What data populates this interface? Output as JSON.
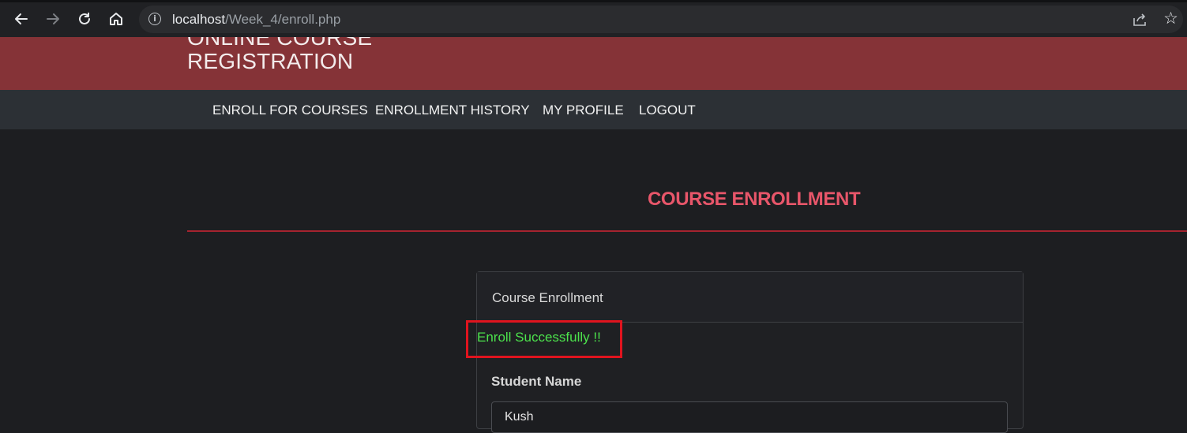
{
  "browser": {
    "url_host": "localhost",
    "url_path": "/Week_4/enroll.php",
    "icons": [
      "back-arrow-icon",
      "forward-arrow-icon",
      "reload-icon",
      "home-icon",
      "info-icon",
      "share-icon",
      "star-icon"
    ]
  },
  "header": {
    "site_title": "ONLINE COURSE REGISTRATION",
    "color": "#853337"
  },
  "nav": {
    "items": [
      {
        "label": "ENROLL FOR COURSES"
      },
      {
        "label": "ENROLLMENT HISTORY"
      },
      {
        "label": "MY PROFILE"
      },
      {
        "label": "LOGOUT"
      }
    ]
  },
  "main": {
    "page_heading": "COURSE ENROLLMENT",
    "heading_color": "#e8566a",
    "card": {
      "title": "Course Enrollment",
      "success_message": "Enroll Successfully !!",
      "success_color": "#4ce34c",
      "fields": [
        {
          "label": "Student Name",
          "value": "Kush"
        }
      ]
    }
  }
}
